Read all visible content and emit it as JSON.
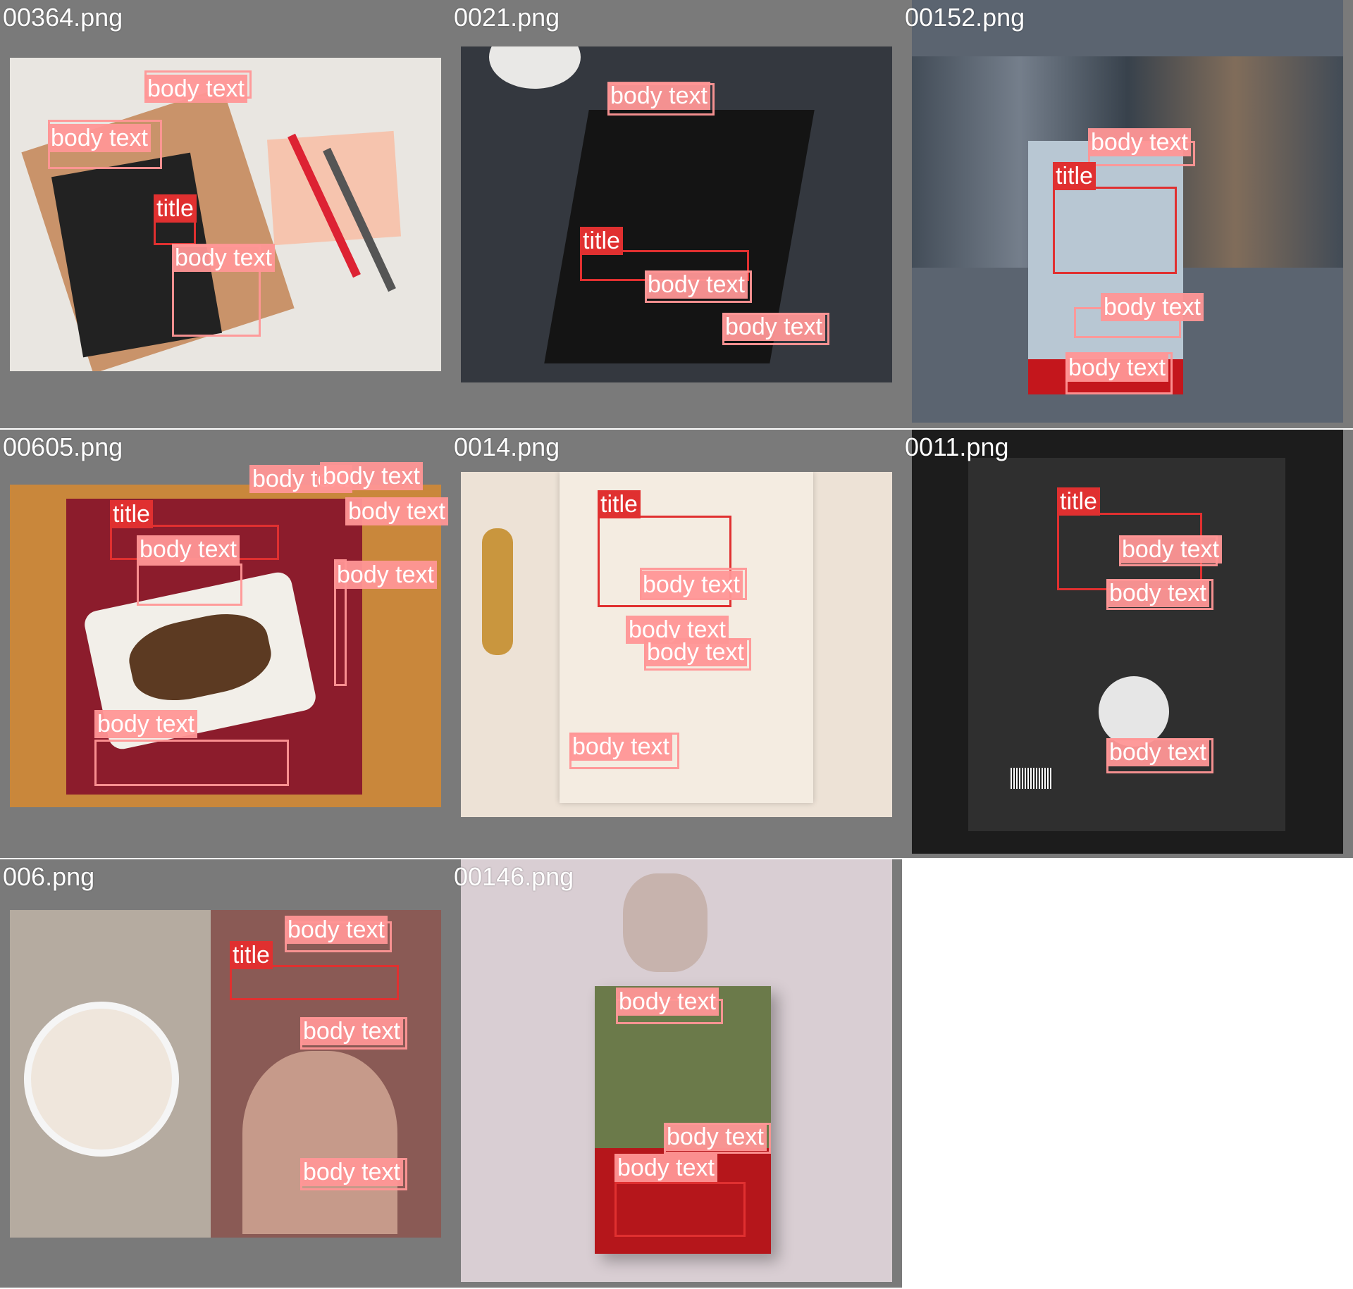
{
  "tiles": [
    {
      "filename": "00364.png"
    },
    {
      "filename": "0021.png"
    },
    {
      "filename": "00152.png"
    },
    {
      "filename": "00605.png"
    },
    {
      "filename": "0014.png"
    },
    {
      "filename": "0011.png"
    },
    {
      "filename": "006.png"
    },
    {
      "filename": "00146.png"
    }
  ],
  "labels": {
    "body": "body text",
    "title": "title"
  }
}
